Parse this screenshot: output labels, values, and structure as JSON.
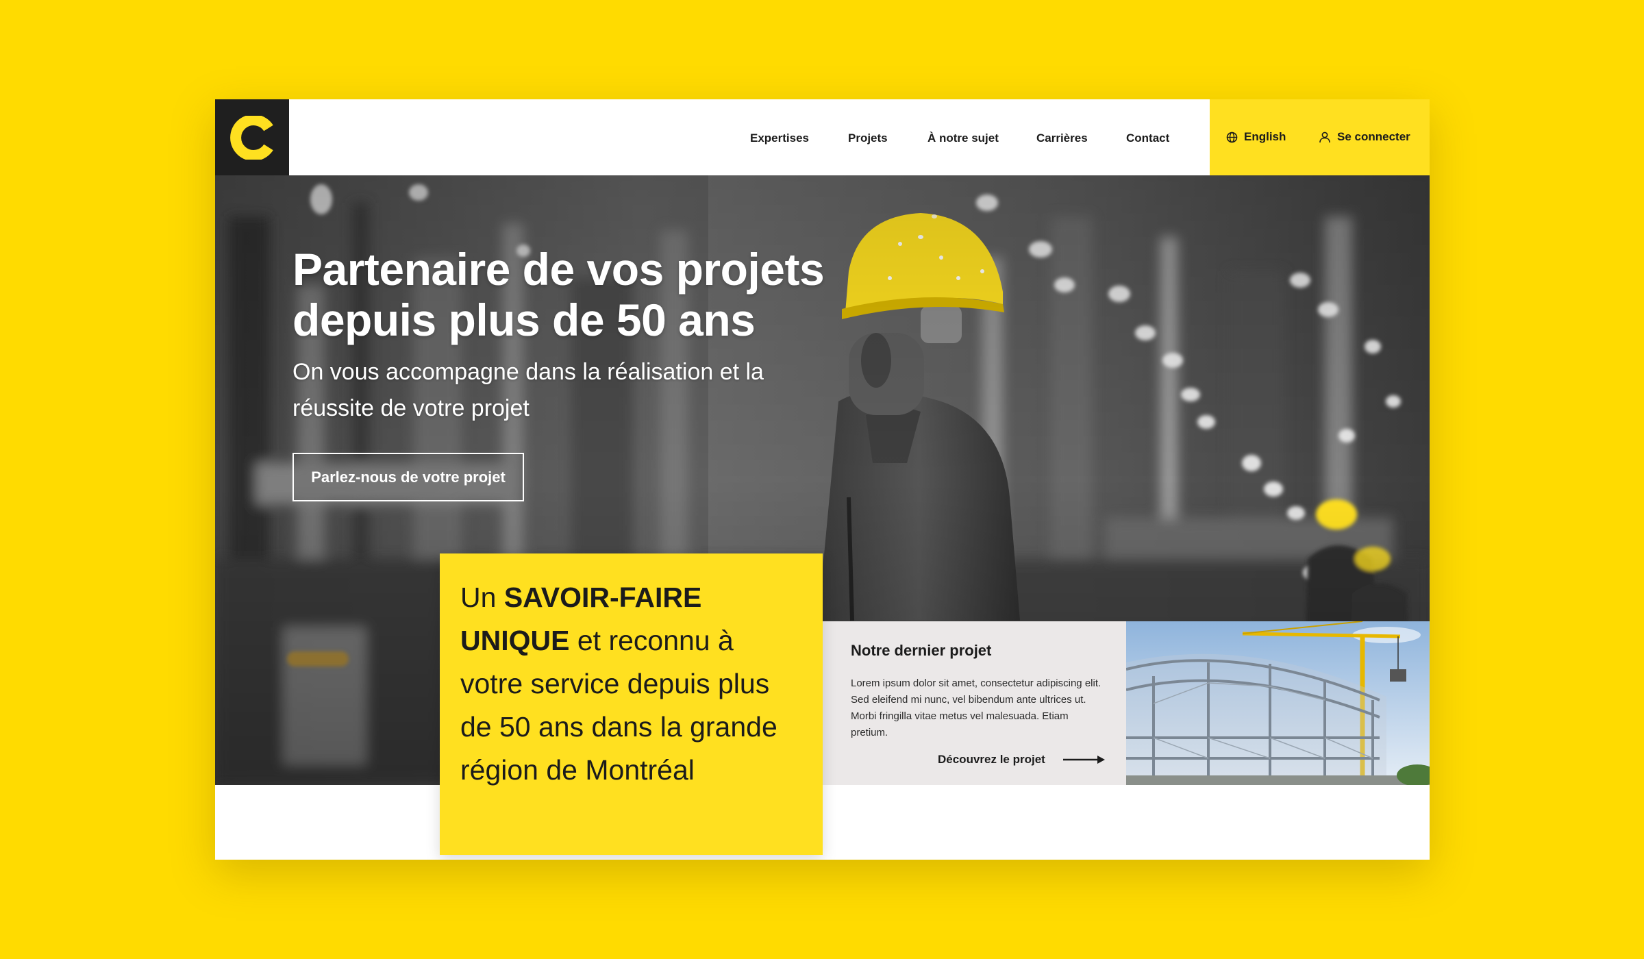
{
  "brand": {
    "logo_letter": "C",
    "colors": {
      "accent": "#FFE020",
      "background": "#FFDB00",
      "dark": "#1f1f1f",
      "text": "#1b1b1b"
    }
  },
  "nav": {
    "items": [
      {
        "label": "Expertises"
      },
      {
        "label": "Projets"
      },
      {
        "label": "À notre sujet"
      },
      {
        "label": "Carrières"
      },
      {
        "label": "Contact"
      }
    ]
  },
  "utility": {
    "language_label": "English",
    "language_icon": "globe-icon",
    "login_label": "Se connecter",
    "login_icon": "user-icon"
  },
  "hero": {
    "title_line1": "Partenaire de vos projets",
    "title_line2": "depuis plus de 50 ans",
    "subtitle": "On vous accompagne dans la réalisation et la réussite de votre projet",
    "cta_label": "Parlez-nous de votre projet"
  },
  "expertise_block": {
    "text_before": "Un ",
    "text_bold": "SAVOIR-FAIRE UNIQUE",
    "text_after": " et reconnu à votre service depuis plus de 50 ans dans la grande région de Montréal"
  },
  "latest_project": {
    "title": "Notre dernier projet",
    "body": "Lorem ipsum dolor sit amet, consectetur adipiscing elit. Sed eleifend mi nunc, vel bibendum ante ultrices ut. Morbi fringilla vitae metus vel malesuada. Etiam pretium.",
    "link_label": "Découvrez le projet",
    "link_icon": "arrow-right-icon"
  }
}
